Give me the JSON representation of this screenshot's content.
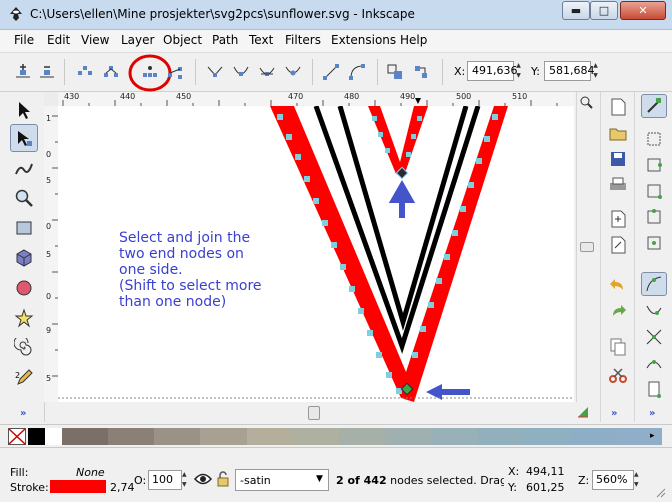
{
  "window": {
    "title": "C:\\Users\\ellen\\Mine prosjekter\\svg2pcs\\sunflower.svg - Inkscape",
    "minimize_icon": "minimize-icon",
    "maximize_icon": "maximize-icon",
    "close_icon": "close-icon"
  },
  "menu": {
    "items": [
      "File",
      "Edit",
      "View",
      "Layer",
      "Object",
      "Path",
      "Text",
      "Filters",
      "Extensions",
      "Help"
    ]
  },
  "controls": {
    "x_label": "X:",
    "x_value": "491,636",
    "y_label": "Y:",
    "y_value": "581,684",
    "icons": [
      "insert-node-icon",
      "delete-node-icon",
      "join-nodes-icon",
      "break-path-icon",
      "join-segment-icon",
      "delete-segment-icon",
      "cusp-node-icon",
      "smooth-node-icon",
      "symmetric-node-icon",
      "auto-node-icon",
      "to-line-icon",
      "to-curve-icon",
      "object-to-path-icon",
      "stroke-to-path-icon"
    ],
    "highlight_color": "#e00000"
  },
  "ruler": {
    "top": [
      "430",
      "440",
      "450",
      "470",
      "480",
      "490",
      "500",
      "510"
    ],
    "left": [
      "1",
      "0",
      "5",
      "0",
      "5",
      "0",
      "9",
      "5"
    ]
  },
  "canvas": {
    "annotation": [
      "Select and join the",
      "two end nodes on",
      "one side.",
      "(Shift to select more",
      "than one node)"
    ],
    "annotation_color": "#3a3fcf",
    "stroke_red": "#ff0000",
    "node_color": "#7ecfe0",
    "arrow_color": "#4455cc"
  },
  "status": {
    "fill_label": "Fill:",
    "fill_value": "None",
    "stroke_label": "Stroke:",
    "stroke_width": "2,74",
    "stroke_color": "#ff0000",
    "opacity_label": "O:",
    "opacity_value": "100",
    "layer_value": "-satin",
    "message_bold": "2 of 442",
    "message_rest": " nodes selected. Drag t...",
    "cursor_x_label": "X:",
    "cursor_x": "494,11",
    "cursor_y_label": "Y:",
    "cursor_y": "601,25",
    "zoom_label": "Z:",
    "zoom_value": "560%"
  },
  "palette": {
    "colors": [
      "#000000",
      "#ffffff",
      "#7a7068",
      "#8a8075",
      "#9a9285",
      "#a8a090",
      "#b4ae9c",
      "#aeb0a0",
      "#a6b0a8",
      "#9eb0b0",
      "#98b0b8",
      "#92b0bc",
      "#8eb0c0",
      "#8eaec6",
      "#90aec8"
    ]
  }
}
